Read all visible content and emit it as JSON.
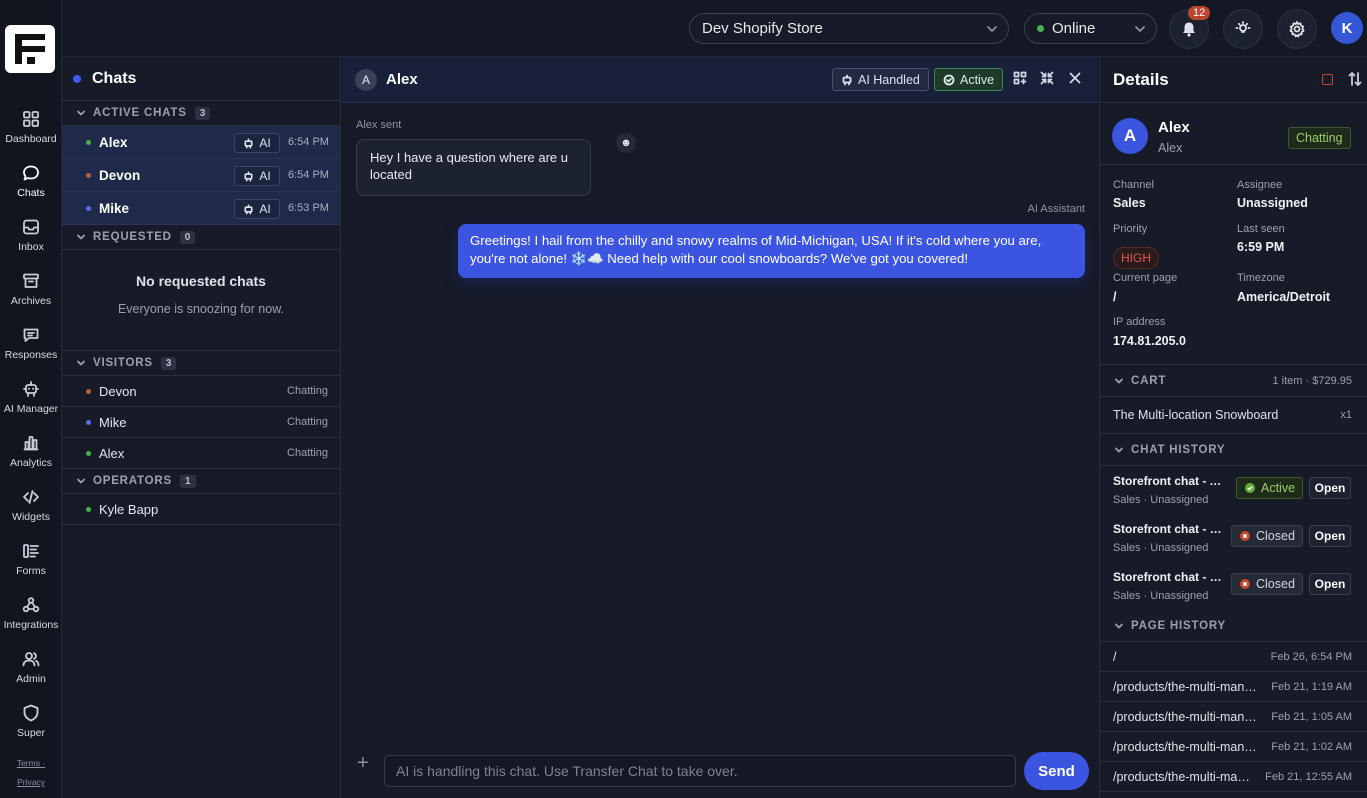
{
  "nav": {
    "items": [
      {
        "label": "Dashboard",
        "icon": "dashboard-icon"
      },
      {
        "label": "Chats",
        "icon": "chat-bubble-icon"
      },
      {
        "label": "Inbox",
        "icon": "inbox-icon"
      },
      {
        "label": "Archives",
        "icon": "archive-icon"
      },
      {
        "label": "Responses",
        "icon": "message-square-icon"
      },
      {
        "label": "AI Manager",
        "icon": "robot-icon"
      },
      {
        "label": "Analytics",
        "icon": "bar-chart-icon"
      },
      {
        "label": "Widgets",
        "icon": "code-icon"
      },
      {
        "label": "Forms",
        "icon": "form-icon"
      },
      {
        "label": "Integrations",
        "icon": "webhook-icon"
      },
      {
        "label": "Admin",
        "icon": "users-icon"
      },
      {
        "label": "Super",
        "icon": "shield-icon"
      }
    ],
    "terms": "Terms",
    "privacy": "Privacy"
  },
  "topbar": {
    "store": "Dev Shopify Store",
    "status": "Online",
    "notifications_count": "12",
    "avatar_initial": "K"
  },
  "chats": {
    "title": "Chats",
    "active": {
      "label": "ACTIVE CHATS",
      "count": "3",
      "items": [
        {
          "name": "Alex",
          "ai": "AI",
          "time": "6:54 PM"
        },
        {
          "name": "Devon",
          "ai": "AI",
          "time": "6:54 PM"
        },
        {
          "name": "Mike",
          "ai": "AI",
          "time": "6:53 PM"
        }
      ]
    },
    "requested": {
      "label": "REQUESTED",
      "count": "0",
      "empty_title": "No requested chats",
      "empty_sub": "Everyone is snoozing for now."
    },
    "visitors": {
      "label": "VISITORS",
      "count": "3",
      "items": [
        {
          "name": "Devon",
          "status": "Chatting"
        },
        {
          "name": "Mike",
          "status": "Chatting"
        },
        {
          "name": "Alex",
          "status": "Chatting"
        }
      ]
    },
    "operators": {
      "label": "OPERATORS",
      "count": "1",
      "items": [
        {
          "name": "Kyle Bapp"
        }
      ]
    }
  },
  "conversation": {
    "avatar_initial": "A",
    "name": "Alex",
    "ai_chip": "AI Handled",
    "status_chip": "Active",
    "incoming_sender": "Alex sent",
    "incoming_text": "Hey I have a question where are u located",
    "outgoing_sender": "AI Assistant",
    "outgoing_text": "Greetings! I hail from the chilly and snowy realms of Mid-Michigan, USA! If it's cold where you are, you're not alone! ❄️☁️ Need help with our cool snowboards? We've got you covered!",
    "input_placeholder": "AI is handling this chat. Use Transfer Chat to take over.",
    "send_label": "Send"
  },
  "details": {
    "title": "Details",
    "visitor_initial": "A",
    "visitor_name": "Alex",
    "visitor_sub": "Alex",
    "visitor_status": "Chatting",
    "channel_label": "Channel",
    "channel": "Sales",
    "assignee_label": "Assignee",
    "assignee": "Unassigned",
    "priority_label": "Priority",
    "priority": "HIGH",
    "last_seen_label": "Last seen",
    "last_seen": "6:59 PM",
    "current_page_label": "Current page",
    "current_page": "/",
    "timezone_label": "Timezone",
    "timezone": "America/Detroit",
    "ip_label": "IP address",
    "ip": "174.81.205.0",
    "cart": {
      "label": "CART",
      "summary": "1 item · $729.95",
      "item": "The Multi-location Snowboard",
      "qty": "x1"
    },
    "chat_history": {
      "label": "CHAT HISTORY",
      "items": [
        {
          "title": "Storefront chat - Active",
          "sub": "Sales · Unassigned",
          "status": "Active",
          "open": "Open"
        },
        {
          "title": "Storefront chat - Closed",
          "sub": "Sales · Unassigned",
          "status": "Closed",
          "open": "Open"
        },
        {
          "title": "Storefront chat - Closed",
          "sub": "Sales · Unassigned",
          "status": "Closed",
          "open": "Open"
        }
      ]
    },
    "page_history": {
      "label": "PAGE HISTORY",
      "items": [
        {
          "path": "/",
          "when": "Feb 26, 6:54 PM"
        },
        {
          "path": "/products/the-multi-man…",
          "when": "Feb 21, 1:19 AM"
        },
        {
          "path": "/products/the-multi-man…",
          "when": "Feb 21, 1:05 AM"
        },
        {
          "path": "/products/the-multi-man…",
          "when": "Feb 21, 1:02 AM"
        },
        {
          "path": "/products/the-multi-ma…",
          "when": "Feb 21, 12:55 AM"
        }
      ]
    }
  },
  "colors": {
    "accent": "#3c55e0",
    "online": "#4caf50",
    "danger": "#e05a4f"
  }
}
